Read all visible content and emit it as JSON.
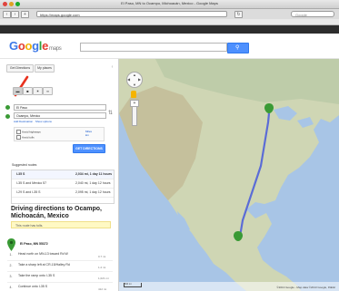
{
  "window": {
    "title": "El Paso, MN to Ocampo, Michoacán, Mexico - Google Maps"
  },
  "toolbar": {
    "url": "https://maps.google.com",
    "search_placeholder": "Google"
  },
  "bookmarks": [
    "Apple",
    "iCloud",
    "Facebook",
    "Twitter",
    "Wikipedia",
    "Yahoo!",
    "News",
    "Popular",
    "Google Maps",
    "YouTube",
    "Amazon"
  ],
  "google_bar": {
    "items": [
      "Web",
      "Images",
      "Videos",
      "Maps",
      "News",
      "Shopping",
      "Gmail",
      "more"
    ],
    "active": "Maps"
  },
  "logo": {
    "text": "Google",
    "sub": "maps"
  },
  "search": {
    "button_icon": "search-icon"
  },
  "panel": {
    "tabs": [
      "Get Directions",
      "My places"
    ],
    "modes": [
      "car-icon",
      "transit-icon",
      "walk-icon",
      "bike-icon"
    ],
    "waypoints": [
      "El Paso",
      "Ocampo, Mexico"
    ],
    "add_destination": "Add Destination",
    "show_options": "Show options",
    "options": [
      "Avoid highways",
      "Avoid tolls"
    ],
    "options_links": [
      "Miles",
      "km"
    ],
    "get_directions_label": "GET DIRECTIONS",
    "suggested_routes_title": "Suggested routes",
    "routes": [
      {
        "name": "I-35 S",
        "dist": "2,034 mi, 1 day 11 hours"
      },
      {
        "name": "I-35 S and Mexico 57",
        "dist": "2,040 mi, 1 day 12 hours"
      },
      {
        "name": "I-29 S and I-35 S",
        "dist": "2,095 mi, 1 day 12 hours"
      }
    ],
    "directions_heading": "Driving directions to Ocampo, Michoacán, Mexico",
    "toll_notice": "This route has tolls.",
    "start_label": "El Paso, MN 55372",
    "steps": [
      {
        "num": "1.",
        "text": "Head north on MN-13 toward Rd W",
        "dist": "0.7 mi"
      },
      {
        "num": "2.",
        "text": "Take a sharp left at CR-15/Halley Rd",
        "dist": "1.2 mi"
      },
      {
        "num": "3.",
        "text": "Take the ramp onto I-35 S",
        "dist": "1,021 mi"
      },
      {
        "num": "4.",
        "text": "Continue onto I-35 S",
        "dist": "412 mi"
      }
    ]
  },
  "map": {
    "attribution": "©2013 Google - Map data ©2013 Google, INEGI",
    "scale": "500 mi",
    "route_color": "#5b6cd6",
    "marker_color": "#3a9a35"
  }
}
